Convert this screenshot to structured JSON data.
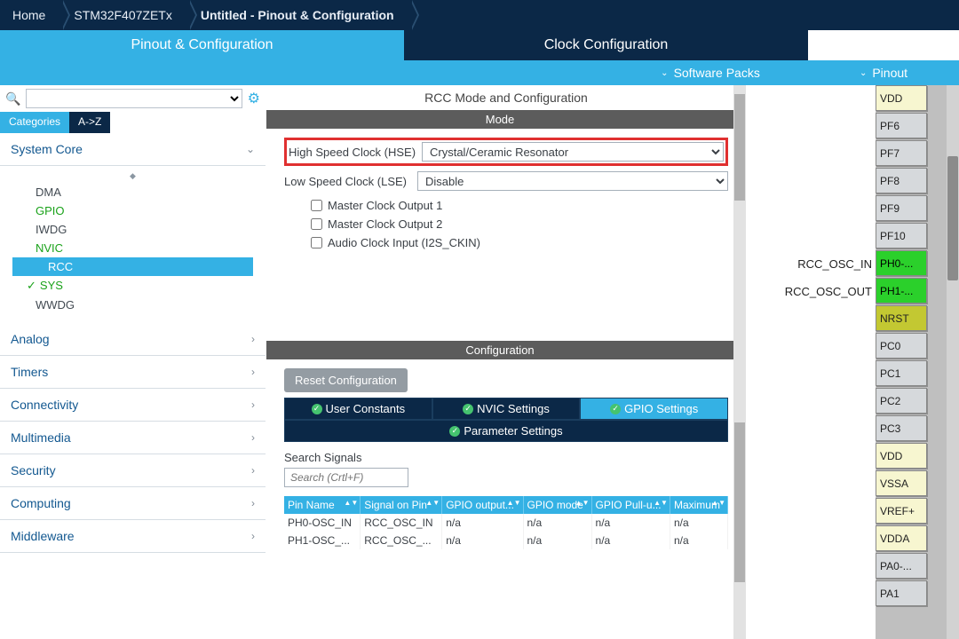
{
  "breadcrumb": {
    "home": "Home",
    "chip": "STM32F407ZETx",
    "view": "Untitled - Pinout & Configuration"
  },
  "tabs": {
    "pinout": "Pinout & Configuration",
    "clock": "Clock Configuration"
  },
  "subtabs": {
    "software": "Software Packs",
    "pinout": "Pinout"
  },
  "left": {
    "viewtabs": {
      "categories": "Categories",
      "az": "A->Z"
    },
    "system_core": "System Core",
    "items": {
      "dma": "DMA",
      "gpio": "GPIO",
      "iwdg": "IWDG",
      "nvic": "NVIC",
      "rcc": "RCC",
      "sys": "SYS",
      "wwdg": "WWDG"
    },
    "sections": {
      "analog": "Analog",
      "timers": "Timers",
      "connectivity": "Connectivity",
      "multimedia": "Multimedia",
      "security": "Security",
      "computing": "Computing",
      "middleware": "Middleware"
    }
  },
  "center": {
    "title": "RCC Mode and Configuration",
    "mode_header": "Mode",
    "hse_label": "High Speed Clock (HSE)",
    "hse_value": "Crystal/Ceramic Resonator",
    "lse_label": "Low Speed Clock (LSE)",
    "lse_value": "Disable",
    "chk1": "Master Clock Output 1",
    "chk2": "Master Clock Output 2",
    "chk3": "Audio Clock Input (I2S_CKIN)",
    "config_header": "Configuration",
    "reset_btn": "Reset Configuration",
    "conf_tabs": {
      "user": "User Constants",
      "nvic": "NVIC Settings",
      "gpio": "GPIO Settings",
      "param": "Parameter Settings"
    },
    "search_label": "Search Signals",
    "search_placeholder": "Search (Crtl+F)",
    "table": {
      "headers": [
        "Pin Name",
        "Signal on Pin",
        "GPIO output...",
        "GPIO mode",
        "GPIO Pull-u...",
        "Maximum"
      ],
      "rows": [
        [
          "PH0-OSC_IN",
          "RCC_OSC_IN",
          "n/a",
          "n/a",
          "n/a",
          "n/a"
        ],
        [
          "PH1-OSC_...",
          "RCC_OSC_...",
          "n/a",
          "n/a",
          "n/a",
          "n/a"
        ]
      ]
    }
  },
  "pins": {
    "labels": {
      "osc_in": "RCC_OSC_IN",
      "osc_out": "RCC_OSC_OUT"
    },
    "list": [
      {
        "name": "VDD",
        "cls": "yellow"
      },
      {
        "name": "PF6",
        "cls": "gray"
      },
      {
        "name": "PF7",
        "cls": "gray"
      },
      {
        "name": "PF8",
        "cls": "gray"
      },
      {
        "name": "PF9",
        "cls": "gray"
      },
      {
        "name": "PF10",
        "cls": "gray"
      },
      {
        "name": "PH0-...",
        "cls": "green"
      },
      {
        "name": "PH1-...",
        "cls": "green"
      },
      {
        "name": "NRST",
        "cls": "olive"
      },
      {
        "name": "PC0",
        "cls": "gray"
      },
      {
        "name": "PC1",
        "cls": "gray"
      },
      {
        "name": "PC2",
        "cls": "gray"
      },
      {
        "name": "PC3",
        "cls": "gray"
      },
      {
        "name": "VDD",
        "cls": "yellow"
      },
      {
        "name": "VSSA",
        "cls": "yellow"
      },
      {
        "name": "VREF+",
        "cls": "yellow"
      },
      {
        "name": "VDDA",
        "cls": "yellow"
      },
      {
        "name": "PA0-...",
        "cls": "gray"
      },
      {
        "name": "PA1",
        "cls": "gray"
      }
    ]
  }
}
